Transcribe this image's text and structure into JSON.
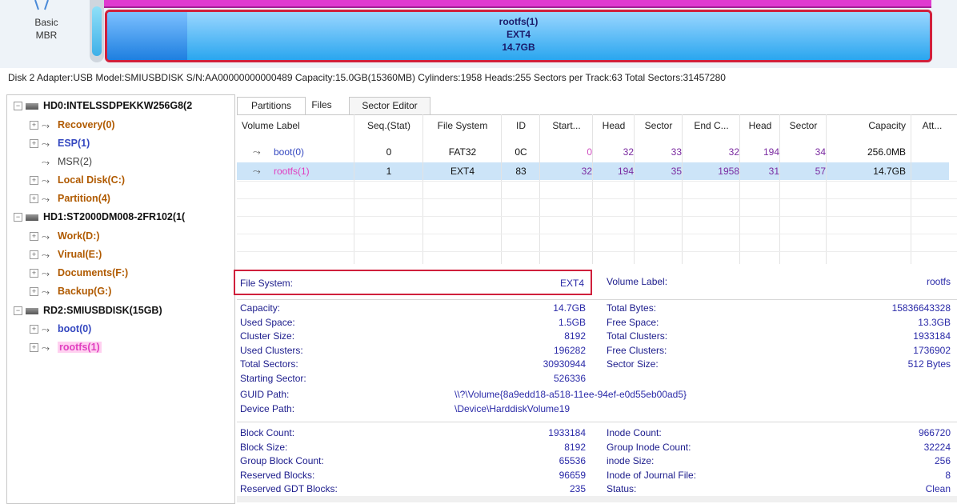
{
  "top": {
    "disk_type": [
      "Basic",
      "MBR"
    ],
    "rootfs_bar": [
      "rootfs(1)",
      "EXT4",
      "14.7GB"
    ]
  },
  "disk_info": "Disk 2 Adapter:USB  Model:SMIUSBDISK  S/N:AA00000000000489  Capacity:15.0GB(15360MB)  Cylinders:1958  Heads:255  Sectors per Track:63  Total Sectors:31457280",
  "tree": [
    {
      "label": "HD0:INTELSSDPEKKW256G8(2",
      "kind": "disk",
      "expander": "⊟",
      "indent": 0
    },
    {
      "label": "Recovery(0)",
      "kind": "brown",
      "expander": "⊞",
      "indent": 1
    },
    {
      "label": "ESP(1)",
      "kind": "blue",
      "expander": "⊞",
      "indent": 1
    },
    {
      "label": "MSR(2)",
      "kind": "gray",
      "expander": "",
      "indent": 1
    },
    {
      "label": "Local Disk(C:)",
      "kind": "brown",
      "expander": "⊞",
      "indent": 1
    },
    {
      "label": "Partition(4)",
      "kind": "brown",
      "expander": "⊞",
      "indent": 1
    },
    {
      "label": "HD1:ST2000DM008-2FR102(1(",
      "kind": "disk",
      "expander": "⊟",
      "indent": 0
    },
    {
      "label": "Work(D:)",
      "kind": "brown",
      "expander": "⊞",
      "indent": 1
    },
    {
      "label": "Virual(E:)",
      "kind": "brown",
      "expander": "⊞",
      "indent": 1
    },
    {
      "label": "Documents(F:)",
      "kind": "brown",
      "expander": "⊞",
      "indent": 1
    },
    {
      "label": "Backup(G:)",
      "kind": "brown",
      "expander": "⊞",
      "indent": 1
    },
    {
      "label": "RD2:SMIUSBDISK(15GB)",
      "kind": "disk",
      "expander": "⊟",
      "indent": 0
    },
    {
      "label": "boot(0)",
      "kind": "blue",
      "expander": "⊞",
      "indent": 1
    },
    {
      "label": "rootfs(1)",
      "kind": "pink",
      "expander": "⊞",
      "indent": 1
    }
  ],
  "tabs": [
    "Partitions",
    "Files",
    "Sector Editor"
  ],
  "table": {
    "headers": [
      "Volume Label",
      "Seq.(Stat)",
      "File System",
      "ID",
      "Start...",
      "Head",
      "Sector",
      "End C...",
      "Head",
      "Sector",
      "Capacity",
      "Att..."
    ],
    "rows": [
      [
        "boot(0)",
        "0",
        "FAT32",
        "0C",
        "0",
        "32",
        "33",
        "32",
        "194",
        "34",
        "256.0MB",
        ""
      ],
      [
        "rootfs(1)",
        "1",
        "EXT4",
        "83",
        "32",
        "194",
        "35",
        "1958",
        "31",
        "57",
        "14.7GB",
        ""
      ]
    ]
  },
  "details": {
    "fs_label": "File System:",
    "fs_value": "EXT4",
    "vl_label": "Volume Label:",
    "vl_value": "rootfs",
    "left1": [
      [
        "Capacity:",
        "14.7GB"
      ],
      [
        "Used Space:",
        "1.5GB"
      ],
      [
        "Cluster Size:",
        "8192"
      ],
      [
        "Used Clusters:",
        "196282"
      ],
      [
        "Total Sectors:",
        "30930944"
      ],
      [
        "Starting Sector:",
        "526336"
      ]
    ],
    "right1": [
      [
        "Total Bytes:",
        "15836643328"
      ],
      [
        "Free Space:",
        "13.3GB"
      ],
      [
        "Total Clusters:",
        "1933184"
      ],
      [
        "Free Clusters:",
        "1736902"
      ],
      [
        "Sector Size:",
        "512 Bytes"
      ]
    ],
    "guid_label": "GUID Path:",
    "guid_value": "\\\\?\\Volume{8a9edd18-a518-11ee-94ef-e0d55eb00ad5}",
    "device_label": "Device Path:",
    "device_value": "\\Device\\HarddiskVolume19",
    "left2": [
      [
        "Block Count:",
        "1933184"
      ],
      [
        "Block Size:",
        "8192"
      ],
      [
        "Group Block Count:",
        "65536"
      ],
      [
        "Reserved Blocks:",
        "96659"
      ],
      [
        "Reserved GDT Blocks:",
        "235"
      ]
    ],
    "right2": [
      [
        "Inode Count:",
        "966720"
      ],
      [
        "Group Inode Count:",
        "32224"
      ],
      [
        "inode Size:",
        "256"
      ],
      [
        "Inode of Journal File:",
        "8"
      ],
      [
        "Status:",
        "Clean"
      ]
    ]
  },
  "colors": {
    "accent_red": "#d0203c",
    "partition_blue": "#2aa6ef",
    "selection": "#cce4f8",
    "pink": "#e03ad0"
  }
}
